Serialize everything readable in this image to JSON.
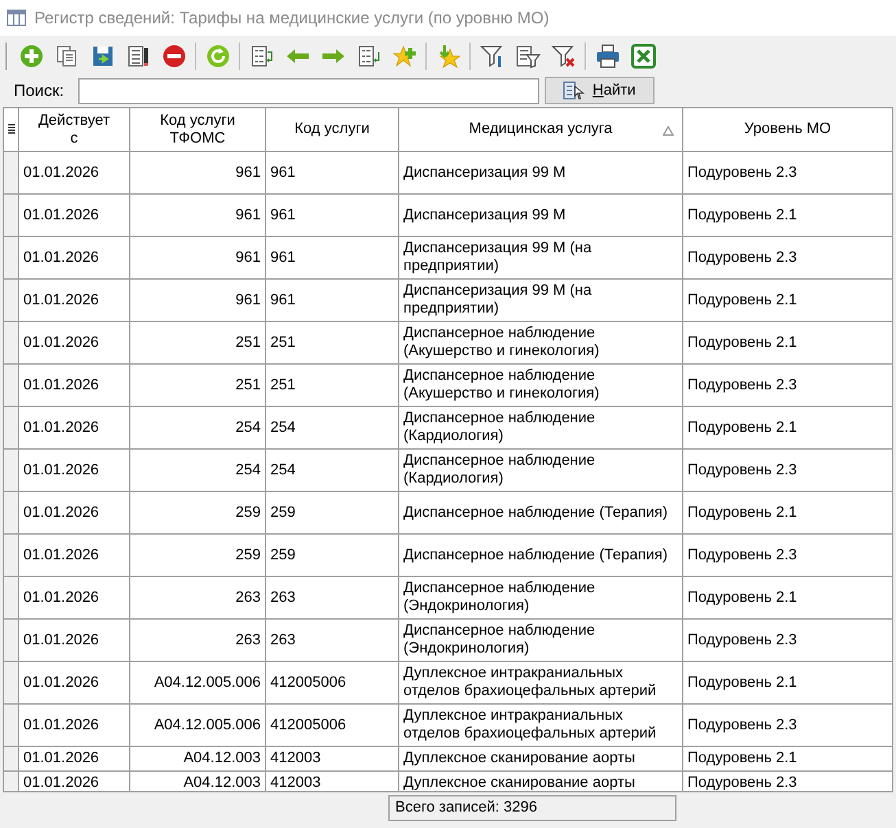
{
  "window": {
    "title": "Регистр сведений: Тарифы на медицинские услуги (по уровню МО)"
  },
  "search": {
    "label": "Поиск:",
    "button": "Найти"
  },
  "table": {
    "columns": [
      {
        "label": "Действует с",
        "sorted": false
      },
      {
        "label": "Код услуги ТФОМС",
        "sorted": false
      },
      {
        "label": "Код услуги",
        "sorted": false
      },
      {
        "label": "Медицинская услуга",
        "sorted": true
      },
      {
        "label": "Уровень МО",
        "sorted": false
      }
    ],
    "rows": [
      {
        "cells": [
          "01.01.2026",
          "961",
          "961",
          "Диспансеризация 99 М",
          "Подуровень 2.3"
        ],
        "compact": false
      },
      {
        "cells": [
          "01.01.2026",
          "961",
          "961",
          "Диспансеризация 99 М",
          "Подуровень 2.1"
        ],
        "compact": false
      },
      {
        "cells": [
          "01.01.2026",
          "961",
          "961",
          "Диспансеризация 99 М (на предприятии)",
          "Подуровень 2.3"
        ],
        "compact": false
      },
      {
        "cells": [
          "01.01.2026",
          "961",
          "961",
          "Диспансеризация 99 М (на предприятии)",
          "Подуровень 2.1"
        ],
        "compact": false
      },
      {
        "cells": [
          "01.01.2026",
          "251",
          "251",
          "Диспансерное наблюдение (Акушерство и гинекология)",
          "Подуровень 2.1"
        ],
        "compact": false
      },
      {
        "cells": [
          "01.01.2026",
          "251",
          "251",
          "Диспансерное наблюдение (Акушерство и гинекология)",
          "Подуровень 2.3"
        ],
        "compact": false
      },
      {
        "cells": [
          "01.01.2026",
          "254",
          "254",
          "Диспансерное наблюдение (Кардиология)",
          "Подуровень 2.1"
        ],
        "compact": false
      },
      {
        "cells": [
          "01.01.2026",
          "254",
          "254",
          "Диспансерное наблюдение (Кардиология)",
          "Подуровень 2.3"
        ],
        "compact": false
      },
      {
        "cells": [
          "01.01.2026",
          "259",
          "259",
          "Диспансерное наблюдение (Терапия)",
          "Подуровень 2.1"
        ],
        "compact": false
      },
      {
        "cells": [
          "01.01.2026",
          "259",
          "259",
          "Диспансерное наблюдение (Терапия)",
          "Подуровень 2.3"
        ],
        "compact": false
      },
      {
        "cells": [
          "01.01.2026",
          "263",
          "263",
          "Диспансерное наблюдение (Эндокринология)",
          "Подуровень 2.1"
        ],
        "compact": false
      },
      {
        "cells": [
          "01.01.2026",
          "263",
          "263",
          "Диспансерное наблюдение (Эндокринология)",
          "Подуровень 2.3"
        ],
        "compact": false
      },
      {
        "cells": [
          "01.01.2026",
          "A04.12.005.006",
          "412005006",
          "Дуплексное интракраниальных отделов брахиоцефальных артерий",
          "Подуровень 2.1"
        ],
        "compact": false
      },
      {
        "cells": [
          "01.01.2026",
          "A04.12.005.006",
          "412005006",
          "Дуплексное интракраниальных отделов брахиоцефальных артерий",
          "Подуровень 2.3"
        ],
        "compact": false
      },
      {
        "cells": [
          "01.01.2026",
          "A04.12.003",
          "412003",
          "Дуплексное сканирование аорты",
          "Подуровень 2.1"
        ],
        "compact": true
      },
      {
        "cells": [
          "01.01.2026",
          "A04.12.003",
          "412003",
          "Дуплексное сканирование аорты",
          "Подуровень 2.3"
        ],
        "compact": true
      }
    ]
  },
  "status_bar": {
    "total": "Всего записей: 3296"
  }
}
